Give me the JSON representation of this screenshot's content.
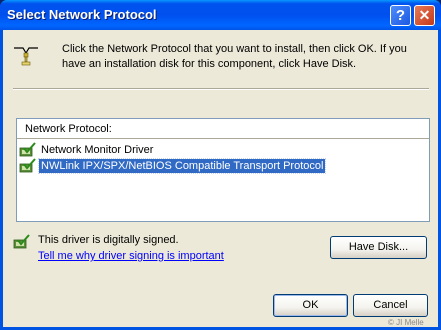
{
  "window": {
    "title": "Select Network Protocol",
    "help_glyph": "?",
    "close_glyph": "✕"
  },
  "header": {
    "icon": "network-cable-icon",
    "instruction": "Click the Network Protocol that you want to install, then click OK. If you have an installation disk for this component, click Have Disk."
  },
  "list": {
    "header": "Network Protocol:",
    "items": [
      {
        "label": "Network Monitor Driver",
        "icon": "signed-driver-icon",
        "selected": false
      },
      {
        "label": "NWLink IPX/SPX/NetBIOS Compatible Transport Protocol",
        "icon": "signed-driver-icon",
        "selected": true
      }
    ]
  },
  "signing": {
    "icon": "signed-driver-icon",
    "text": "This driver is digitally signed.",
    "link": "Tell me why driver signing is important"
  },
  "buttons": {
    "have_disk": "Have Disk...",
    "ok": "OK",
    "cancel": "Cancel"
  },
  "watermark": "© JI Melle",
  "colors": {
    "titlebar": "#0054e3",
    "client_bg": "#ece9d8",
    "selection": "#316ac5",
    "link": "#0000ff"
  }
}
